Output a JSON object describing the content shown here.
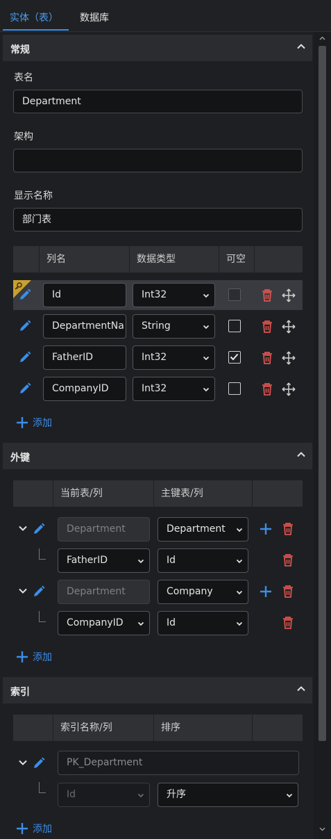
{
  "tabs": [
    {
      "label": "实体（表）",
      "active": true
    },
    {
      "label": "数据库",
      "active": false
    }
  ],
  "general": {
    "title": "常规",
    "table_name_label": "表名",
    "table_name_value": "Department",
    "schema_label": "架构",
    "schema_value": "",
    "display_name_label": "显示名称",
    "display_name_value": "部门表"
  },
  "columns": {
    "headers": [
      "列名",
      "数据类型",
      "可空"
    ],
    "rows": [
      {
        "name": "Id",
        "type": "Int32",
        "nullable": false,
        "primary_key": true
      },
      {
        "name": "DepartmentNa",
        "type": "String",
        "nullable": false,
        "primary_key": false
      },
      {
        "name": "FatherID",
        "type": "Int32",
        "nullable": true,
        "primary_key": false
      },
      {
        "name": "CompanyID",
        "type": "Int32",
        "nullable": false,
        "primary_key": false
      }
    ],
    "add_label": "添加"
  },
  "foreign_keys": {
    "title": "外键",
    "headers": [
      "当前表/列",
      "主键表/列"
    ],
    "items": [
      {
        "current_table": "Department",
        "primary_table": "Department",
        "current_column": "FatherID",
        "primary_column": "Id"
      },
      {
        "current_table": "Department",
        "primary_table": "Company",
        "current_column": "CompanyID",
        "primary_column": "Id"
      }
    ],
    "add_label": "添加"
  },
  "indexes": {
    "title": "索引",
    "headers": [
      "索引名称/列",
      "排序"
    ],
    "items": [
      {
        "name": "PK_Department",
        "column": "Id",
        "order": "升序"
      }
    ],
    "add_label": "添加"
  },
  "colors": {
    "accent": "#3b8eea",
    "delete": "#d9534f",
    "key_badge": "#c8a030"
  }
}
